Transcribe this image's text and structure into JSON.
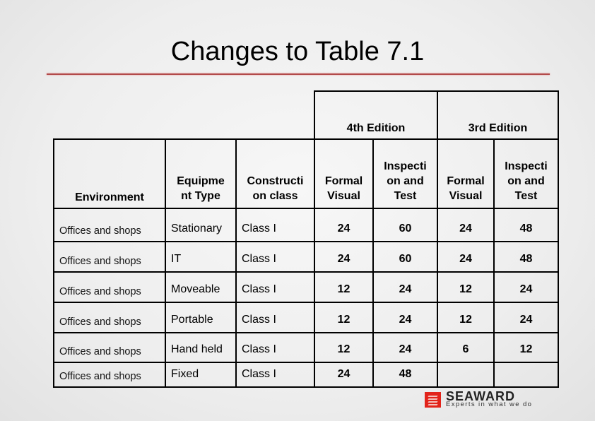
{
  "slide": {
    "title": "Changes to Table 7.1"
  },
  "table": {
    "group_headers": [
      "4th Edition",
      "3rd Edition"
    ],
    "columns": [
      "Environment",
      "Equipme nt Type",
      "Constructi on class",
      "Formal Visual",
      "Inspecti on and Test",
      "Formal Visual",
      "Inspecti on and Test"
    ],
    "column_lines": [
      [
        "Environment"
      ],
      [
        "Equipme",
        "nt Type"
      ],
      [
        "Constructi",
        "on class"
      ],
      [
        "Formal",
        "Visual"
      ],
      [
        "Inspecti",
        "on and",
        "Test"
      ],
      [
        "Formal",
        "Visual"
      ],
      [
        "Inspecti",
        "on and",
        "Test"
      ]
    ],
    "rows": [
      [
        "Offices and shops",
        "Stationary",
        "Class I",
        "24",
        "60",
        "24",
        "48"
      ],
      [
        "Offices and shops",
        "IT",
        "Class I",
        "24",
        "60",
        "24",
        "48"
      ],
      [
        "Offices and shops",
        "Moveable",
        "Class I",
        "12",
        "24",
        "12",
        "24"
      ],
      [
        "Offices and shops",
        "Portable",
        "Class I",
        "12",
        "24",
        "12",
        "24"
      ],
      [
        "Offices and shops",
        "Hand held",
        "Class I",
        "12",
        "24",
        "6",
        "12"
      ],
      [
        "Offices and shops",
        "Fixed",
        "Class I",
        "24",
        "48",
        "",
        ""
      ]
    ]
  },
  "logo": {
    "name": "SEAWARD",
    "tagline": "Experts in what we do",
    "color": "#e2231a"
  },
  "colors": {
    "rule": "#b24a4a"
  }
}
